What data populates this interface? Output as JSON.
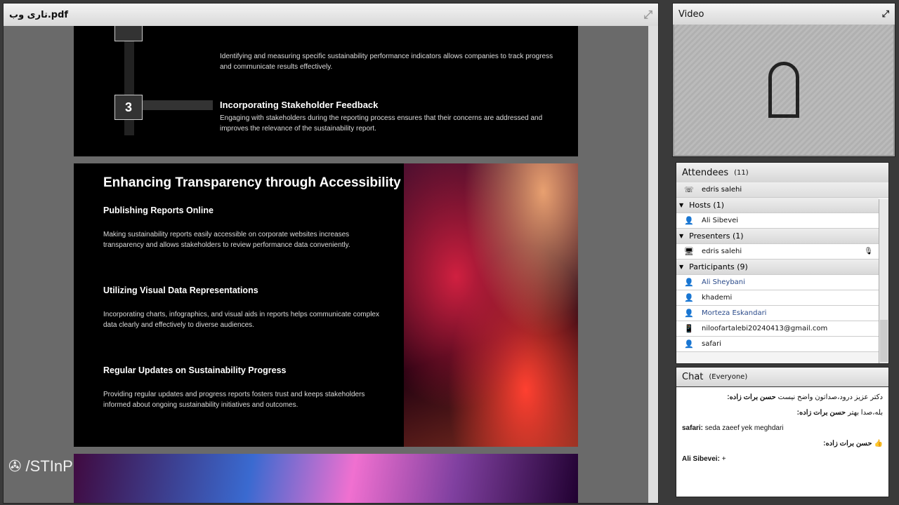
{
  "pdf": {
    "title": "تاری وب.pdf",
    "slide1": {
      "item2_desc": "Identifying and measuring specific sustainability performance indicators allows companies to track progress and communicate results effectively.",
      "item3_num": "3",
      "item3_title": "Incorporating Stakeholder Feedback",
      "item3_desc": "Engaging with stakeholders during the reporting process ensures that their concerns are addressed and improves the relevance of the sustainability report."
    },
    "slide2": {
      "title": "Enhancing Transparency through Accessibility",
      "sections": [
        {
          "heading": "Publishing Reports Online",
          "body": "Making sustainability reports easily accessible on corporate websites increases transparency and allows stakeholders to review performance data conveniently."
        },
        {
          "heading": "Utilizing Visual Data Representations",
          "body": "Incorporating charts, infographics, and visual aids in reports helps communicate complex data clearly and effectively to diverse audiences."
        },
        {
          "heading": "Regular Updates on Sustainability Progress",
          "body": "Providing regular updates and progress reports fosters trust and keeps stakeholders informed about ongoing sustainability initiatives and outcomes."
        }
      ]
    }
  },
  "watermark": "/STInP",
  "video": {
    "title": "Video"
  },
  "attendees": {
    "title": "Attendees",
    "count": "(11)",
    "speaker": "edris salehi",
    "groups": [
      {
        "label": "Hosts (1)",
        "members": [
          {
            "name": "Ali Sibevei",
            "icon": "host-icon",
            "color": "#111"
          }
        ]
      },
      {
        "label": "Presenters (1)",
        "members": [
          {
            "name": "edris salehi",
            "icon": "presenter-icon",
            "color": "#111"
          }
        ]
      },
      {
        "label": "Participants (9)",
        "members": [
          {
            "name": "Ali Sheybani",
            "icon": "user-icon",
            "color": "#2a4a8a"
          },
          {
            "name": "khademi",
            "icon": "user-icon",
            "color": "#111"
          },
          {
            "name": "Morteza Eskandari",
            "icon": "user-icon",
            "color": "#2a4a8a"
          },
          {
            "name": "niloofartalebi20240413@gmail.com",
            "icon": "mobile-user-icon",
            "color": "#111"
          },
          {
            "name": "safari",
            "icon": "user-icon",
            "color": "#111"
          }
        ]
      }
    ]
  },
  "chat": {
    "title": "Chat",
    "scope": "(Everyone)",
    "messages": [
      {
        "sender": "حسن برات زاده:",
        "text": "دکتر عزیز درود،صداتون واضح نیست",
        "rtl": true
      },
      {
        "sender": "حسن برات زاده:",
        "text": "بله،صدا بهتر",
        "rtl": true
      },
      {
        "sender": "safari:",
        "text": "seda zaeef yek meghdari",
        "rtl": false
      },
      {
        "sender": "حسن برات زاده:",
        "text": "👍",
        "rtl": true
      },
      {
        "sender": "Ali Sibevei:",
        "text": "+",
        "rtl": false
      }
    ]
  }
}
